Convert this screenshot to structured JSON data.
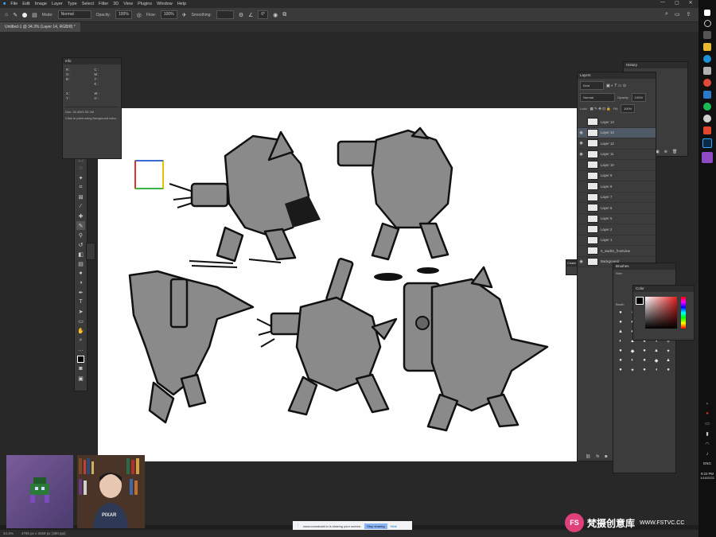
{
  "menu": {
    "items": [
      "File",
      "Edit",
      "Image",
      "Layer",
      "Type",
      "Select",
      "Filter",
      "3D",
      "View",
      "Plugins",
      "Window",
      "Help"
    ]
  },
  "options": {
    "mode_label": "Mode:",
    "mode_value": "Normal",
    "opacity_label": "Opacity:",
    "opacity_value": "100%",
    "flow_label": "Flow:",
    "flow_value": "100%",
    "smoothing_label": "Smoothing:",
    "angle_value": "0°"
  },
  "document": {
    "tab_title": "Untitled-1 @ 34.3% (Layer 14, RGB/8) *",
    "zoom": "34.3%",
    "doc_size": "4705 px x 3469 px (300 ppi)"
  },
  "info_panel": {
    "title": "Info",
    "values": [
      "R :",
      "G :",
      "B :",
      "C :",
      "M :",
      "Y :",
      "K :",
      "X :",
      "Y :",
      "W :",
      "H :"
    ],
    "doc_line": "Doc: 33.4M/1.00.1M",
    "hint": "Click to paint using foreground color..."
  },
  "layers_panel": {
    "title": "Layers",
    "kind_label": "Kind",
    "blend_mode": "Normal",
    "opacity_label": "Opacity:",
    "opacity_value": "100%",
    "lock_label": "Lock:",
    "fill_label": "Fill:",
    "fill_value": "100%",
    "layers": [
      {
        "name": "Layer 13",
        "visible": false
      },
      {
        "name": "Layer 14",
        "visible": true,
        "selected": true
      },
      {
        "name": "Layer 12",
        "visible": true
      },
      {
        "name": "Layer 11",
        "visible": true
      },
      {
        "name": "Layer 10",
        "visible": false
      },
      {
        "name": "Layer 9",
        "visible": false
      },
      {
        "name": "Layer 8",
        "visible": false
      },
      {
        "name": "Layer 7",
        "visible": false
      },
      {
        "name": "Layer 6",
        "visible": false
      },
      {
        "name": "Layer 5",
        "visible": false
      },
      {
        "name": "Layer 2",
        "visible": false
      },
      {
        "name": "Layer 1",
        "visible": false
      },
      {
        "name": "rt_swd01_frontview",
        "visible": false
      },
      {
        "name": "Background",
        "visible": true
      }
    ]
  },
  "history_panel": {
    "title": "History"
  },
  "brushes_panel": {
    "title": "Brushes",
    "size_label": "Size:",
    "group_label": "Brush"
  },
  "color_panel": {
    "title": "Color"
  },
  "channels_panel": {
    "title": "Chann"
  },
  "share_bar": {
    "message": "www.crowdcast.io is sharing your screen.",
    "stop_label": "Stop sharing",
    "hide_label": "Hide"
  },
  "taskbar": {
    "lang": "ENG",
    "time": "9:22 PM",
    "date": "1/16/2022"
  },
  "watermark": {
    "logo_letters": "FS",
    "text_cn": "梵摄创意库",
    "url": "WWW.FSTVC.CC"
  },
  "webcam": {
    "shirt_text": "PIXAR"
  },
  "colors": {
    "accent": "#2d8ceb",
    "selection": "#505a66",
    "stop_button": "#8ab4f8",
    "watermark_pink": "#e0407a"
  }
}
